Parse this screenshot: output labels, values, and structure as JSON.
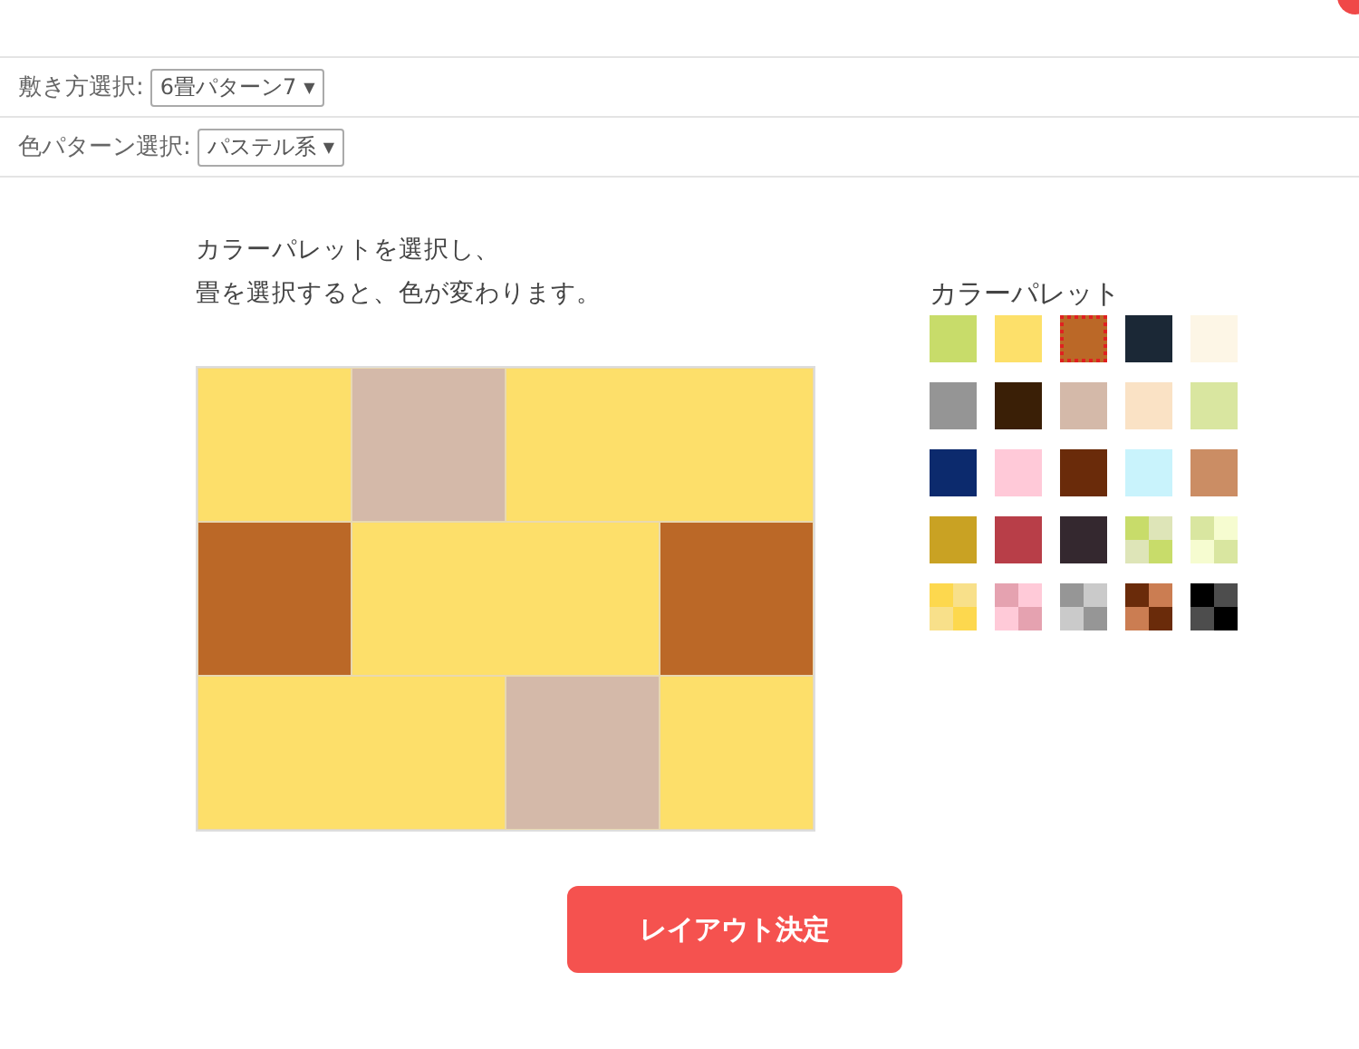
{
  "layout_select": {
    "label": "敷き方選択:",
    "value": "6畳パターン7",
    "arrow": "▼"
  },
  "color_select": {
    "label": "色パターン選択:",
    "value": "パステル系",
    "arrow": "▼"
  },
  "instructions": [
    "カラーパレットを選択し、",
    "畳を選択すると、色が変わります。"
  ],
  "tatami_rows": [
    [
      {
        "kind": "half",
        "color": "#fddf6a"
      },
      {
        "kind": "half",
        "color": "#d4b9a9"
      },
      {
        "kind": "full",
        "color": "#fddf6a"
      }
    ],
    [
      {
        "kind": "half",
        "color": "#bb6827"
      },
      {
        "kind": "full",
        "color": "#fddf6a"
      },
      {
        "kind": "half",
        "color": "#bb6827"
      }
    ],
    [
      {
        "kind": "full",
        "color": "#fddf6a"
      },
      {
        "kind": "half",
        "color": "#d4b9a9"
      },
      {
        "kind": "half",
        "color": "#fddf6a"
      }
    ]
  ],
  "palette": {
    "title": "カラーパレット",
    "swatches": [
      {
        "kind": "solid",
        "color": "#c8dc6a",
        "selected": false
      },
      {
        "kind": "solid",
        "color": "#fde06a",
        "selected": false
      },
      {
        "kind": "solid",
        "color": "#bb6827",
        "selected": true
      },
      {
        "kind": "solid",
        "color": "#1b2836",
        "selected": false
      },
      {
        "kind": "solid",
        "color": "#fdf6e6",
        "selected": false
      },
      {
        "kind": "solid",
        "color": "#959595",
        "selected": false
      },
      {
        "kind": "solid",
        "color": "#3a1f06",
        "selected": false
      },
      {
        "kind": "solid",
        "color": "#d4b9a9",
        "selected": false
      },
      {
        "kind": "solid",
        "color": "#fae2c5",
        "selected": false
      },
      {
        "kind": "solid",
        "color": "#d9e6a0",
        "selected": false
      },
      {
        "kind": "solid",
        "color": "#0c2a6d",
        "selected": false
      },
      {
        "kind": "solid",
        "color": "#ffc9d8",
        "selected": false
      },
      {
        "kind": "solid",
        "color": "#6a2b0a",
        "selected": false
      },
      {
        "kind": "solid",
        "color": "#c9f3fc",
        "selected": false
      },
      {
        "kind": "solid",
        "color": "#cb8d64",
        "selected": false
      },
      {
        "kind": "solid",
        "color": "#c9a223",
        "selected": false
      },
      {
        "kind": "solid",
        "color": "#b83e48",
        "selected": false
      },
      {
        "kind": "solid",
        "color": "#34282f",
        "selected": false
      },
      {
        "kind": "check",
        "cells": [
          {
            "color": "#c8dc6a"
          },
          {
            "color": "#dee5b8"
          },
          {
            "color": "#dee5b8"
          },
          {
            "color": "#c8dc6a"
          }
        ],
        "selected": false
      },
      {
        "kind": "check",
        "cells": [
          {
            "color": "#d9e6a0"
          },
          {
            "color": "#f6fcd0"
          },
          {
            "color": "#f6fcd0"
          },
          {
            "color": "#d9e6a0"
          }
        ],
        "selected": false
      },
      {
        "kind": "check",
        "cells": [
          {
            "color": "#fdd84e"
          },
          {
            "color": "#f8e08a"
          },
          {
            "color": "#f8e08a"
          },
          {
            "color": "#fdd84e"
          }
        ],
        "selected": false
      },
      {
        "kind": "check",
        "cells": [
          {
            "color": "#e5a2b0"
          },
          {
            "color": "#ffcad8"
          },
          {
            "color": "#ffcad8"
          },
          {
            "color": "#e5a2b0"
          }
        ],
        "selected": false
      },
      {
        "kind": "check",
        "cells": [
          {
            "color": "#969696"
          },
          {
            "color": "#cacaca"
          },
          {
            "color": "#cacaca"
          },
          {
            "color": "#969696"
          }
        ],
        "selected": false
      },
      {
        "kind": "check",
        "cells": [
          {
            "color": "#6a2b0a"
          },
          {
            "color": "#cb7d52"
          },
          {
            "color": "#cb7d52"
          },
          {
            "color": "#6a2b0a"
          }
        ],
        "selected": false
      },
      {
        "kind": "check",
        "cells": [
          {
            "color": "#000000"
          },
          {
            "color": "#4d4d4d"
          },
          {
            "color": "#4d4d4d"
          },
          {
            "color": "#000000"
          }
        ],
        "selected": false
      }
    ]
  },
  "submit_button": "レイアウト決定"
}
